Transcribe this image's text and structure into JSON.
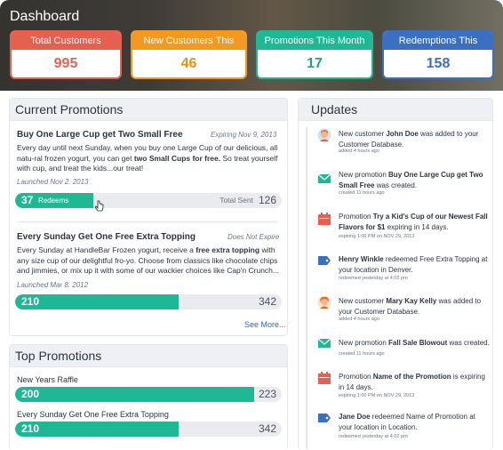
{
  "header": {
    "title": "Dashboard"
  },
  "stats": [
    {
      "label": "Total Customers",
      "value": "995",
      "color": "#e5604e"
    },
    {
      "label": "New Customers This Month",
      "value": "46",
      "color": "#f39a1e"
    },
    {
      "label": "Promotions This Month",
      "value": "17",
      "color": "#1fb894"
    },
    {
      "label": "Redemptions This Month",
      "value": "158",
      "color": "#3a6fc2"
    }
  ],
  "current": {
    "title": "Current Promotions",
    "promos": [
      {
        "title": "Buy One Large Cup get Two Small Free",
        "meta": "Expiring Nov 9, 2013",
        "desc_parts": [
          "Every day until next Sunday, when you buy one Large Cup of our delicious, all natu-",
          "ral frozen yogurt, you can get ",
          "two Small Cups for free.",
          " So treat yourself with cup, and treat the kids...our treat!"
        ],
        "launched": "Launched Nov 2. 2013",
        "redeems": "37",
        "redeems_label": "Redeems",
        "total_label": "Total Sent",
        "total": "126",
        "fraction": 0.294
      },
      {
        "title": "Every Sunday Get One Free Extra Topping",
        "meta": "Does Not Expire",
        "desc_parts": [
          "Every Sunday at HandleBar Frozen yogurt, receive a ",
          "free extra topping",
          " with any size cup of our delightful fro-yo. Choose from classics like chocolate chips and jimmies, or mix up it with some of our wackier choices like Cap'n Crunch..."
        ],
        "launched": "Launched Mar 8. 2012",
        "redeems": "210",
        "total": "342",
        "fraction": 0.614
      }
    ],
    "see_more": "See More..."
  },
  "top": {
    "title": "Top Promotions",
    "items": [
      {
        "label": "New Years Raffle",
        "value": "200",
        "total": "223",
        "fraction": 0.897
      },
      {
        "label": "Every Sunday Get One Free Extra Topping",
        "value": "210",
        "total": "342",
        "fraction": 0.614
      }
    ]
  },
  "updates": {
    "title": "Updates",
    "items": [
      {
        "icon": "avatar-icon",
        "pre": "New customer ",
        "bold": "John Doe",
        "post": " was added to your Customer Database.",
        "time": "added 4 hours ago"
      },
      {
        "icon": "envelope-icon",
        "pre": "New promotion ",
        "bold": "Buy One Large Cup get Two Small Free",
        "post": " was created.",
        "time": "created 11 hours ago"
      },
      {
        "icon": "calendar-icon",
        "pre": "Promotion ",
        "bold": "Try a Kid's Cup of our Newest Fall Flavors for $1",
        "post": " expiring in 14 days.",
        "time": "expiring 1:00 PM on NOV 29, 2013"
      },
      {
        "icon": "tag-icon",
        "pre": "",
        "bold": "Henry Winkle",
        "post": " redeemed Free Extra Topping at your location in Denver.",
        "time": "redeemed yesterday at 4:02 pm"
      },
      {
        "icon": "avatar-icon",
        "pre": "New customer ",
        "bold": "Mary Kay Kelly",
        "post": " was added to your Customer Database.",
        "time": "added 4 hours ago"
      },
      {
        "icon": "envelope-icon",
        "pre": "New promotion ",
        "bold": "Fall Sale Blowout",
        "post": " was created.",
        "time": "created 11 hours ago"
      },
      {
        "icon": "calendar-icon",
        "pre": "Promotion ",
        "bold": "Name of the Promotion",
        "post": " is expiring in 14 days.",
        "time": "expiring 1:00 PM on NOV 29, 2013"
      },
      {
        "icon": "tag-icon",
        "pre": "",
        "bold": "Jane Doe",
        "post": " redeemed Name of Promotion at your location in Location.",
        "time": "redeemed yesterday at 4:02 pm"
      }
    ]
  }
}
